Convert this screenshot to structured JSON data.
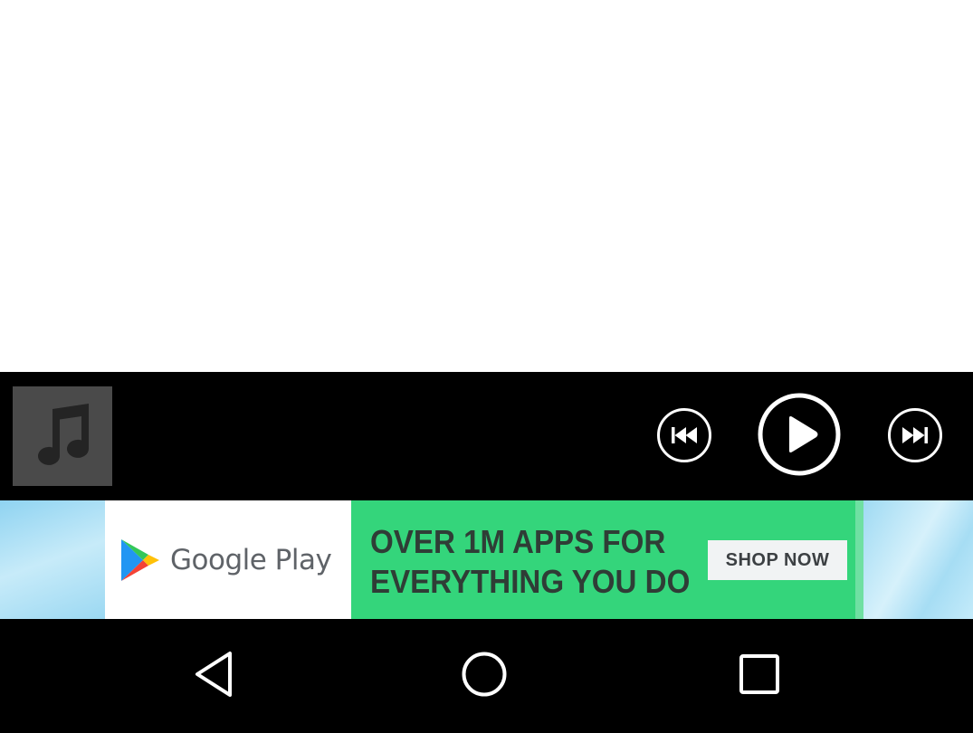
{
  "player": {
    "album_art_icon": "music-note-icon",
    "controls": {
      "previous_icon": "skip-previous-icon",
      "play_icon": "play-icon",
      "next_icon": "skip-next-icon"
    }
  },
  "ad": {
    "brand": "Google Play",
    "brand_icon": "google-play-logo",
    "headline_line1": "OVER 1M APPS FOR",
    "headline_line2": "EVERYTHING YOU DO",
    "cta_label": "SHOP NOW",
    "colors": {
      "green": "#34d57b",
      "text": "#2f3d36"
    }
  },
  "navigation": {
    "back_icon": "back-triangle-icon",
    "home_icon": "home-circle-icon",
    "recents_icon": "recents-square-icon"
  }
}
